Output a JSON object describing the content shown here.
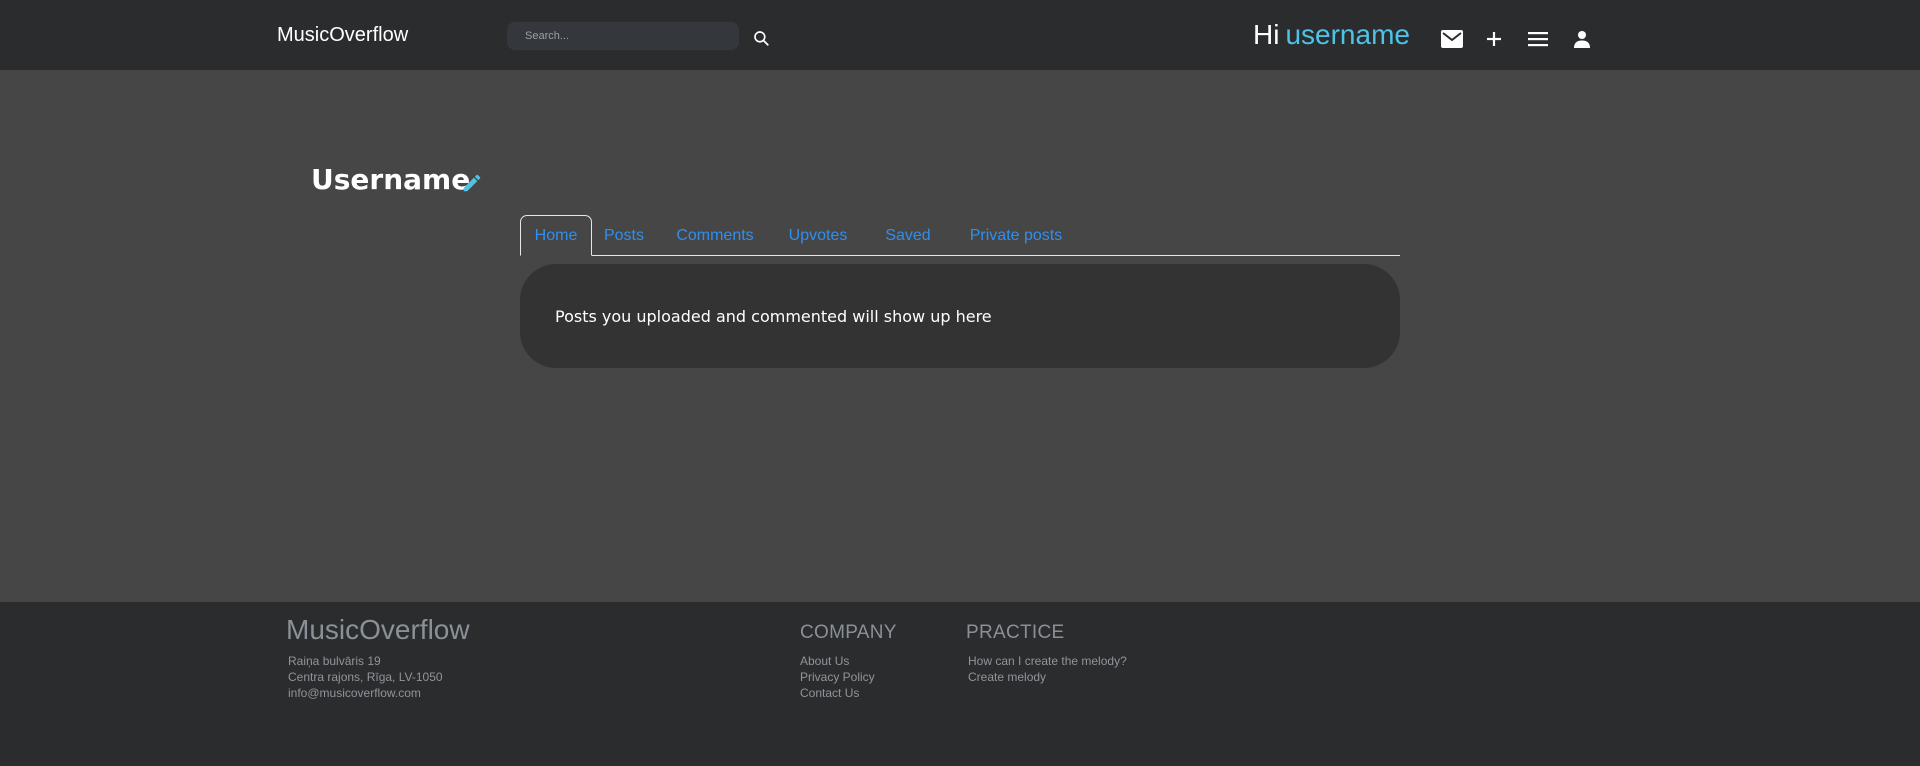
{
  "header": {
    "brand": "MusicOverflow",
    "search": {
      "placeholder": "Search..."
    },
    "greeting": {
      "hi": "Hi",
      "username": "username"
    },
    "icons": [
      "mail-icon",
      "plus-icon",
      "menu-icon",
      "user-icon"
    ]
  },
  "profile": {
    "name": "Username",
    "edit_icon": "pencil-icon"
  },
  "tabs": [
    {
      "label": "Home",
      "active": true
    },
    {
      "label": "Posts",
      "active": false
    },
    {
      "label": "Comments",
      "active": false
    },
    {
      "label": "Upvotes",
      "active": false
    },
    {
      "label": "Saved",
      "active": false
    },
    {
      "label": "Private posts",
      "active": false
    }
  ],
  "content": {
    "empty_message": "Posts you uploaded and commented will show up here"
  },
  "footer": {
    "brand": "MusicOverflow",
    "address": [
      "Raiņa bulvāris 19",
      "Centra rajons, Rīga, LV-1050",
      "info@musicoverflow.com"
    ],
    "company": {
      "heading": "COMPANY",
      "links": [
        "About Us",
        "Privacy Policy",
        "Contact Us"
      ]
    },
    "practice": {
      "heading": "PRACTICE",
      "links": [
        "How can I create the melody?",
        "Create melody"
      ]
    }
  },
  "colors": {
    "background": "#464646",
    "header_bg": "#2b2c2e",
    "accent_username": "#4ec3e6",
    "tab_link": "#2f8ff0",
    "card_bg": "#333333",
    "footer_text": "#8f959c"
  }
}
